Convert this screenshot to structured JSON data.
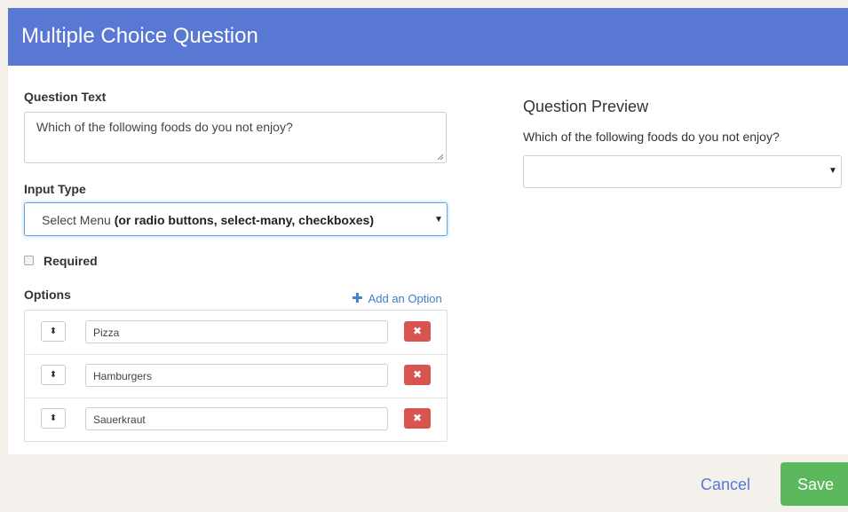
{
  "header": {
    "title": "Multiple Choice Question"
  },
  "form": {
    "question_text_label": "Question Text",
    "question_text_value": "Which of the following foods do you not enjoy?",
    "input_type_label": "Input Type",
    "input_type_value_plain": "Select Menu ",
    "input_type_value_bold": "(or radio buttons, select-many, checkboxes)",
    "required_label": "Required",
    "required_checked": false,
    "options_label": "Options",
    "add_option_label": "Add an Option",
    "options": [
      {
        "value": "Pizza"
      },
      {
        "value": "Hamburgers"
      },
      {
        "value": "Sauerkraut"
      }
    ]
  },
  "preview": {
    "title": "Question Preview",
    "question": "Which of the following foods do you not enjoy?",
    "selected": ""
  },
  "footer": {
    "cancel_label": "Cancel",
    "save_label": "Save"
  },
  "colors": {
    "header": "#5878d4",
    "danger": "#d9534f",
    "success": "#5cb85c",
    "link": "#3d7fc8",
    "footer": "#f4f1ec"
  },
  "icons": {
    "add": "plus-icon",
    "sort": "sort-handle-icon",
    "delete": "close-icon",
    "dropdown": "caret-down-icon"
  }
}
